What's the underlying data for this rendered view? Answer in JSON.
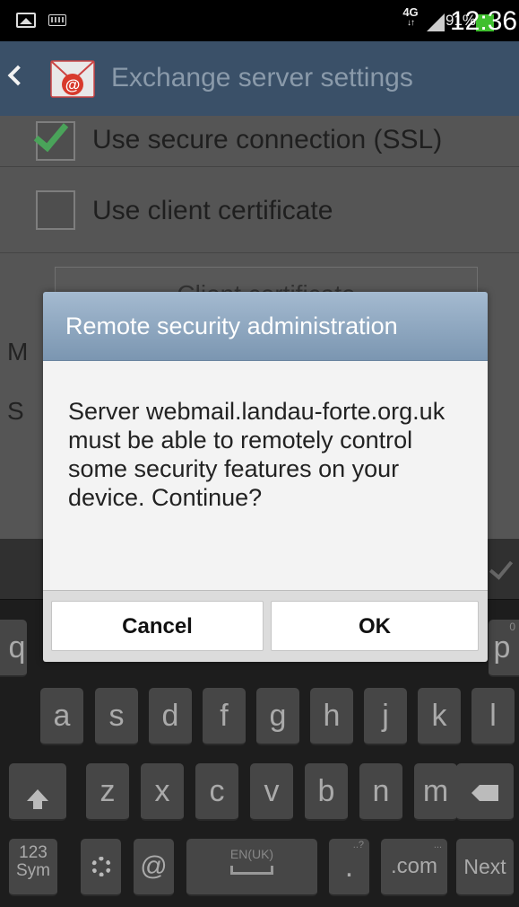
{
  "status_bar": {
    "network": "4G",
    "network_arrows": "↓↑",
    "battery_percent": "91%",
    "time": "12:36"
  },
  "action_bar": {
    "title": "Exchange server settings"
  },
  "settings": {
    "ssl": {
      "label": "Use secure connection (SSL)",
      "checked": true
    },
    "client_cert": {
      "label": "Use client certificate",
      "checked": false
    },
    "cert_button_label": "Client certificate",
    "bg_label_1": "M",
    "bg_label_2": "S"
  },
  "dialog": {
    "title": "Remote security administration",
    "message": "Server webmail.landau-forte.org.uk must be able to remotely control some security features on your device. Continue?",
    "cancel_label": "Cancel",
    "ok_label": "OK"
  },
  "keyboard": {
    "row1_edge_left": "q",
    "row1_edge_right": "p",
    "row1_hint_right": "0",
    "row2": [
      "a",
      "s",
      "d",
      "f",
      "g",
      "h",
      "j",
      "k",
      "l"
    ],
    "row3": [
      "z",
      "x",
      "c",
      "v",
      "b",
      "n",
      "m"
    ],
    "sym_label_top": "123",
    "sym_label_bottom": "Sym",
    "at_label": "@",
    "space_label": "EN(UK)",
    "period_label": ".",
    "period_hint": "..?",
    "com_label": ".com",
    "com_hint": "...",
    "next_label": "Next"
  }
}
